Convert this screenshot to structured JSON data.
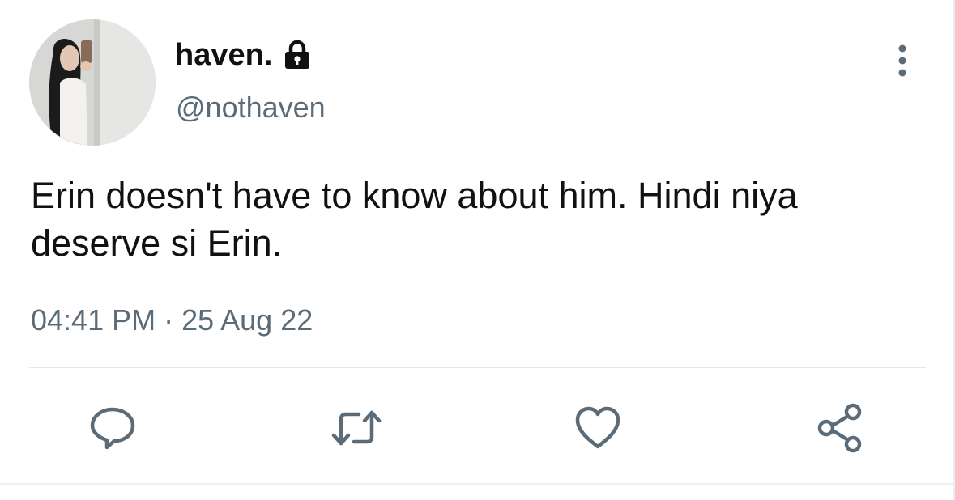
{
  "user": {
    "display_name": "haven.",
    "handle": "@nothaven",
    "protected": true,
    "avatar_icon": "profile-photo"
  },
  "tweet": {
    "text": "Erin doesn't have to know about him. Hindi niya deserve si Erin.",
    "timestamp": "04:41 PM · 25 Aug 22"
  },
  "actions": [
    {
      "name": "reply",
      "icon": "speech-bubble-icon"
    },
    {
      "name": "retweet",
      "icon": "retweet-icon"
    },
    {
      "name": "like",
      "icon": "heart-icon"
    },
    {
      "name": "share",
      "icon": "share-icon"
    }
  ],
  "colors": {
    "text": "#111111",
    "secondary": "#5b6b78",
    "divider": "#e4e8eb",
    "background": "#ffffff"
  }
}
